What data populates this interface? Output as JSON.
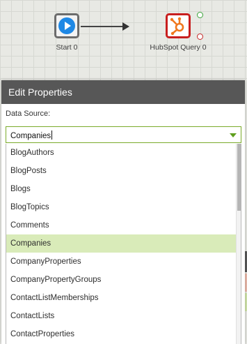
{
  "canvas": {
    "start_node": {
      "label": "Start 0",
      "icon": "play-icon"
    },
    "hubspot_node": {
      "label": "HubSpot Query 0",
      "icon": "hubspot-icon"
    }
  },
  "dialog": {
    "title": "Edit Properties",
    "data_source": {
      "label": "Data Source:",
      "value": "Companies",
      "options": [
        "BlogAuthors",
        "BlogPosts",
        "Blogs",
        "BlogTopics",
        "Comments",
        "Companies",
        "CompanyProperties",
        "CompanyPropertyGroups",
        "ContactListMemberships",
        "ContactLists",
        "ContactProperties"
      ],
      "selected_index": 5
    }
  },
  "colors": {
    "accent_green": "#7aab2a",
    "selected_row": "#d9ebb9",
    "header_bg": "#575757",
    "start_blue": "#1e88e5",
    "hubspot_orange": "#f0781e"
  }
}
